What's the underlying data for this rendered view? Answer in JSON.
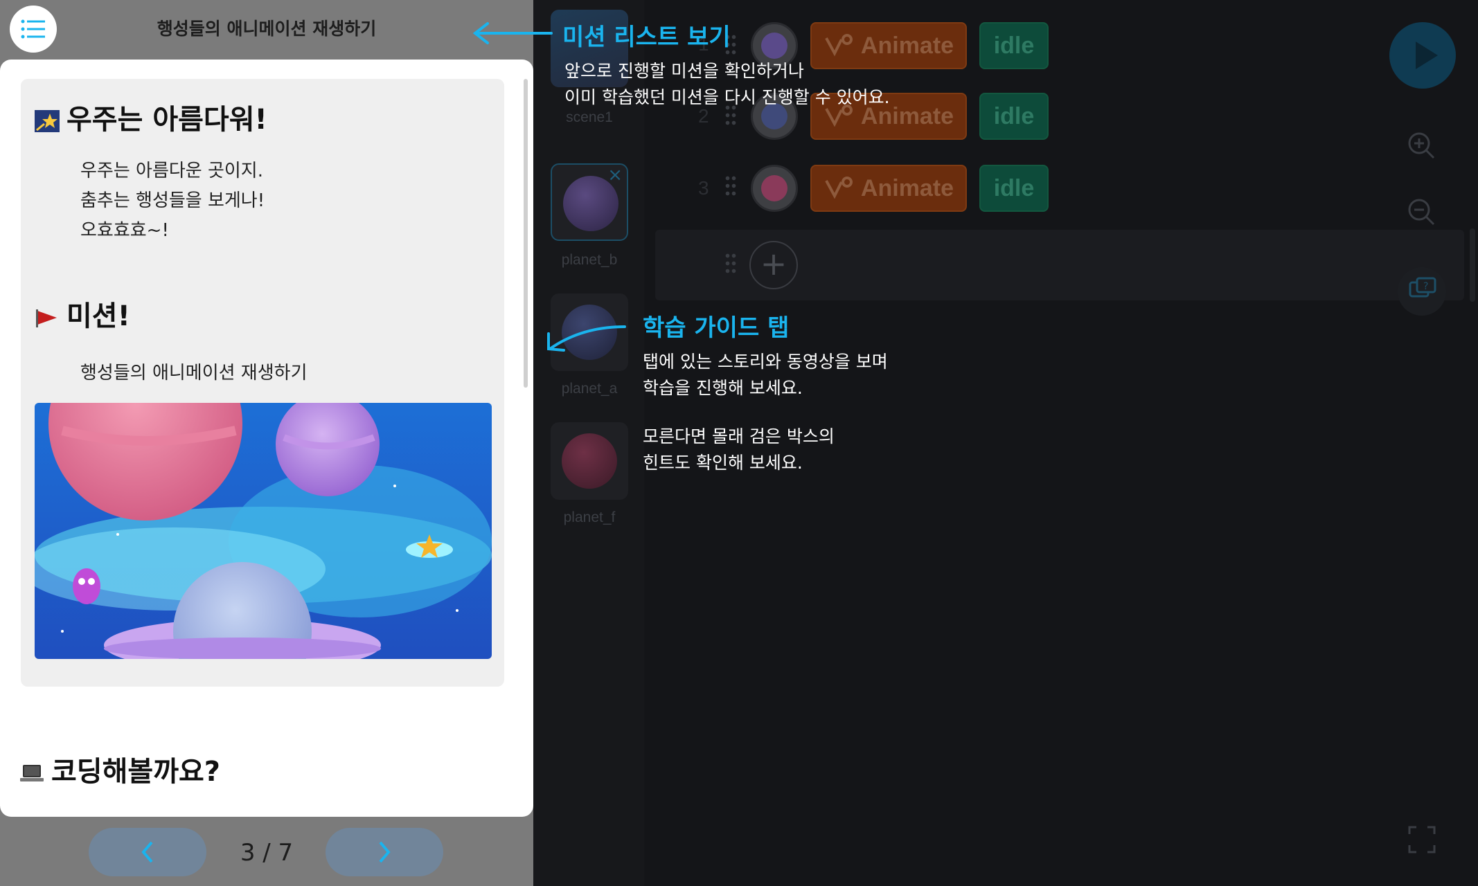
{
  "guide": {
    "title": "행성들의 애니메이션 재생하기",
    "heading1": "우주는 아름다워!",
    "story": [
      "우주는 아름다운 곳이지.",
      "춤추는 행성들을 보게나!",
      "오효효효~!"
    ],
    "heading2": "미션!",
    "mission": "행성들의 애니메이션 재생하기",
    "heading3": "코딩해볼까요?",
    "pager": "3 / 7"
  },
  "sprites": [
    {
      "label": "scene1"
    },
    {
      "label": "planet_b"
    },
    {
      "label": "planet_a"
    },
    {
      "label": "planet_f"
    }
  ],
  "code_rows": [
    {
      "num": "1",
      "animate": "Animate",
      "state": "idle",
      "color": "#5a4a8a"
    },
    {
      "num": "2",
      "animate": "Animate",
      "state": "idle",
      "color": "#3f4a7a"
    },
    {
      "num": "3",
      "animate": "Animate",
      "state": "idle",
      "color": "#8a3a5a"
    }
  ],
  "overlay": {
    "mission_list_title": "미션 리스트 보기",
    "mission_list_text": [
      "앞으로 진행할 미션을 확인하거나",
      "이미 학습했던 미션을 다시 진행할 수 있어요."
    ],
    "guide_tab_title": "학습 가이드 탭",
    "guide_tab_text1": [
      "탭에 있는 스토리와 동영상을 보며",
      "학습을 진행해 보세요."
    ],
    "guide_tab_text2": [
      "모른다면 몰래 검은 박스의",
      "힌트도 확인해 보세요."
    ]
  },
  "colors": {
    "accent": "#1ab4ee",
    "animate": "#6b2d0d",
    "idle": "#0d4b3a"
  }
}
